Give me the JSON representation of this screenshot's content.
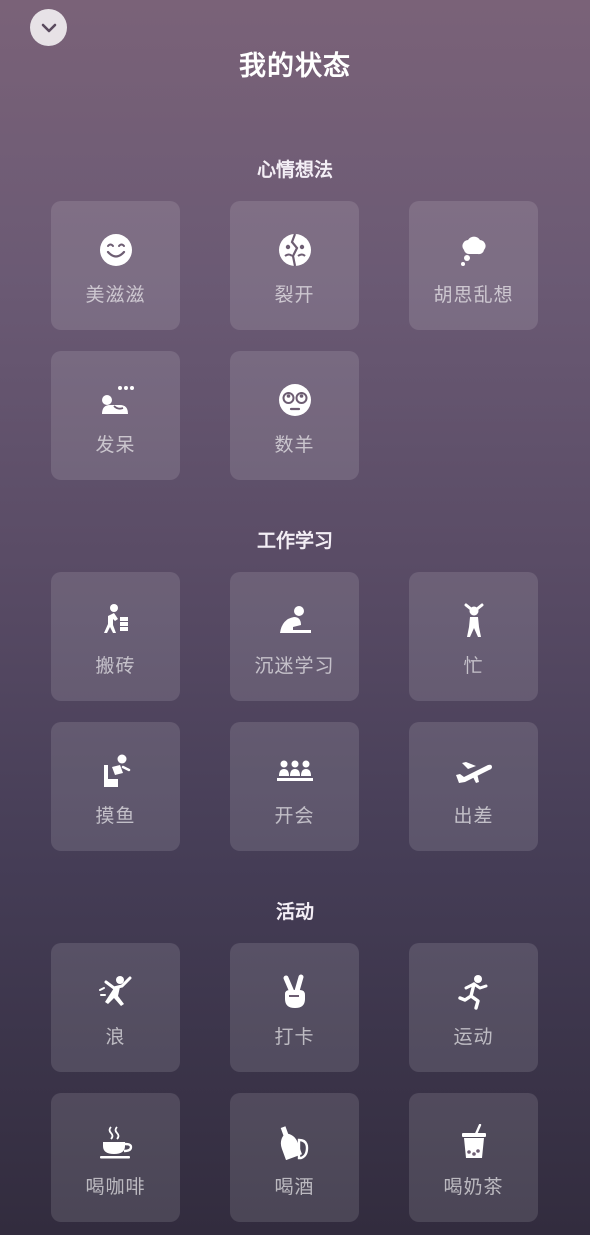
{
  "header": {
    "title": "我的状态",
    "collapse_icon": "chevron-down-icon"
  },
  "sections": [
    {
      "title": "心情想法",
      "items": [
        {
          "label": "美滋滋",
          "icon": "smile-icon"
        },
        {
          "label": "裂开",
          "icon": "cracked-face-icon"
        },
        {
          "label": "胡思乱想",
          "icon": "thought-bubble-icon"
        },
        {
          "label": "发呆",
          "icon": "daydream-icon"
        },
        {
          "label": "数羊",
          "icon": "sleepy-face-icon"
        }
      ]
    },
    {
      "title": "工作学习",
      "items": [
        {
          "label": "搬砖",
          "icon": "carry-bricks-icon"
        },
        {
          "label": "沉迷学习",
          "icon": "study-icon"
        },
        {
          "label": "忙",
          "icon": "busy-person-icon"
        },
        {
          "label": "摸鱼",
          "icon": "slacking-icon"
        },
        {
          "label": "开会",
          "icon": "meeting-icon"
        },
        {
          "label": "出差",
          "icon": "airplane-icon"
        }
      ]
    },
    {
      "title": "活动",
      "items": [
        {
          "label": "浪",
          "icon": "party-dance-icon"
        },
        {
          "label": "打卡",
          "icon": "victory-hand-icon"
        },
        {
          "label": "运动",
          "icon": "running-icon"
        },
        {
          "label": "喝咖啡",
          "icon": "coffee-icon"
        },
        {
          "label": "喝酒",
          "icon": "wine-bottle-icon"
        },
        {
          "label": "喝奶茶",
          "icon": "bubble-tea-icon"
        }
      ]
    }
  ]
}
